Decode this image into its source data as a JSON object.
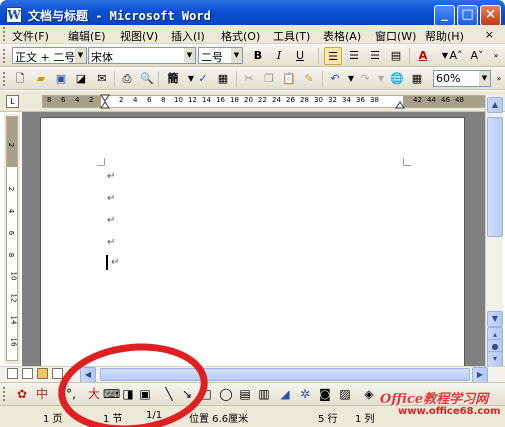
{
  "window": {
    "title": "文档与标题 - Microsoft Word",
    "app_icon": "W",
    "controls": [
      "minimize",
      "maximize",
      "close"
    ]
  },
  "menubar": {
    "items": [
      {
        "label": "文件(F)"
      },
      {
        "label": "编辑(E)"
      },
      {
        "label": "视图(V)"
      },
      {
        "label": "插入(I)"
      },
      {
        "label": "格式(O)"
      },
      {
        "label": "工具(T)"
      },
      {
        "label": "表格(A)"
      },
      {
        "label": "窗口(W)"
      },
      {
        "label": "帮助(H)"
      }
    ],
    "right": "×"
  },
  "formatting": {
    "style": "正文 + 二号",
    "font": "宋体",
    "size": "二号",
    "bold": "B",
    "italic": "I",
    "underline": "U",
    "font_color": "A",
    "grow": "A˄",
    "shrink": "A˅"
  },
  "standard": {
    "zoom": "60%",
    "traditional": "簡"
  },
  "ruler": {
    "numbers": [
      "8",
      "6",
      "4",
      "2",
      "2",
      "4",
      "6",
      "8",
      "10",
      "12",
      "14",
      "16",
      "18",
      "20",
      "22",
      "24",
      "26",
      "28",
      "30",
      "32",
      "34",
      "36",
      "38",
      "42",
      "44",
      "46",
      "48"
    ]
  },
  "vruler": {
    "numbers": [
      "2",
      "2",
      "4",
      "6",
      "8",
      "10",
      "12",
      "14",
      "16"
    ]
  },
  "document": {
    "para_mark": "↵"
  },
  "drawing": {
    "ime_chars": [
      "中",
      "•",
      "°,",
      "大"
    ]
  },
  "status": {
    "page": "1 页",
    "section": "1 节",
    "pages": "1/1",
    "position": "位置 6.6厘米",
    "line": "5 行",
    "column": "1 列"
  },
  "watermark": {
    "brand": "Office教程学习网",
    "url": "www.office68.com"
  },
  "colors": {
    "titlebar": "#0a4fd0",
    "chrome": "#ece9d8",
    "annotation": "#e02020"
  }
}
